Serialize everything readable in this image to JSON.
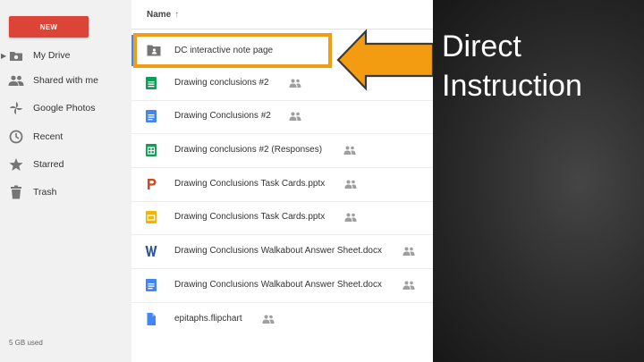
{
  "sidebar": {
    "new_label": "NEW",
    "items": [
      {
        "label": "My Drive",
        "icon": "drive-icon"
      },
      {
        "label": "Shared with me",
        "icon": "people-icon"
      },
      {
        "label": "Google Photos",
        "icon": "pinwheel-icon"
      },
      {
        "label": "Recent",
        "icon": "clock-icon"
      },
      {
        "label": "Starred",
        "icon": "star-icon"
      },
      {
        "label": "Trash",
        "icon": "trash-icon"
      }
    ],
    "storage": "5 GB used"
  },
  "list": {
    "header": "Name",
    "sort_arrow": "↑",
    "files": [
      {
        "name": "DC interactive note page",
        "type": "shared-folder",
        "shared": false
      },
      {
        "name": "Drawing conclusions #2",
        "type": "sheets",
        "shared": true
      },
      {
        "name": "Drawing Conclusions #2",
        "type": "docs",
        "shared": true
      },
      {
        "name": "Drawing conclusions #2 (Responses)",
        "type": "sheets",
        "shared": true
      },
      {
        "name": "Drawing Conclusions Task Cards.pptx",
        "type": "pptx",
        "shared": true
      },
      {
        "name": "Drawing Conclusions Task Cards.pptx",
        "type": "slides",
        "shared": true
      },
      {
        "name": "Drawing Conclusions Walkabout Answer Sheet.docx",
        "type": "word",
        "shared": true
      },
      {
        "name": "Drawing Conclusions Walkabout Answer Sheet.docx",
        "type": "docs",
        "shared": true
      },
      {
        "name": "epitaphs.flipchart",
        "type": "generic",
        "shared": true
      }
    ]
  },
  "slide": {
    "title_line1": "Direct",
    "title_line2": "Instruction"
  },
  "colors": {
    "new_button": "#db4437",
    "highlight": "#f39c12",
    "docs": "#4285f4",
    "sheets": "#0f9d58",
    "slides": "#f4b400",
    "pptx": "#d24726",
    "word": "#2b579a"
  }
}
